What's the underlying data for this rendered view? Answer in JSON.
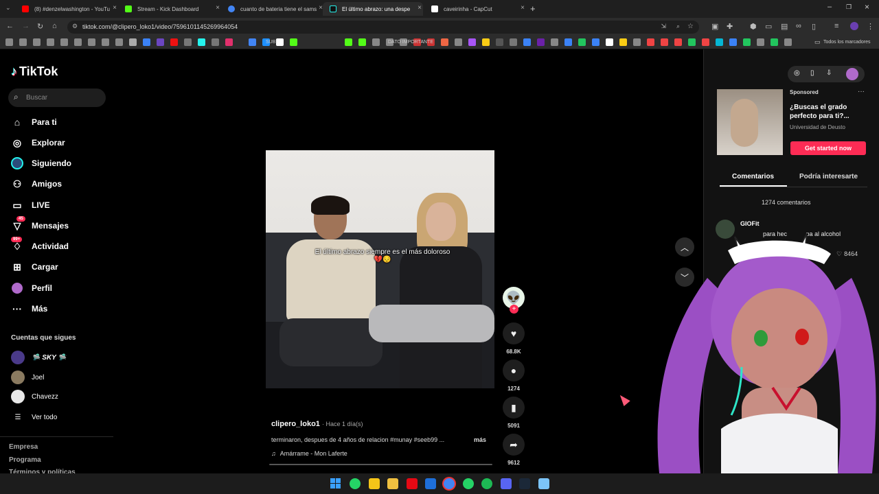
{
  "browser": {
    "tabs": [
      {
        "label": "(8) #denzelwashington - YouTu",
        "color": "#ff0000"
      },
      {
        "label": "Stream - Kick Dashboard",
        "color": "#53fc18"
      },
      {
        "label": "cuanto de bateria tiene el sams",
        "color": "#4285f4"
      },
      {
        "label": "El último abrazo: una despe",
        "color": "#25f4ee"
      },
      {
        "label": "caveirinha - CapCut",
        "color": "#ffffff"
      }
    ],
    "url": "tiktok.com/@clipero_loko1/video/7596101145269964054",
    "bookmark_texts": [
      "SUB",
      "DATO IMPORTANTE",
      "Todos los marcadores"
    ]
  },
  "tiktok": {
    "logo": "TikTok",
    "search_placeholder": "Buscar",
    "nav": [
      {
        "label": "Para ti",
        "icon": "home-icon"
      },
      {
        "label": "Explorar",
        "icon": "compass-icon"
      },
      {
        "label": "Siguiendo",
        "icon": "following-icon"
      },
      {
        "label": "Amigos",
        "icon": "friends-icon"
      },
      {
        "label": "LIVE",
        "icon": "live-icon"
      },
      {
        "label": "Mensajes",
        "icon": "messages-icon",
        "badge": "45"
      },
      {
        "label": "Actividad",
        "icon": "activity-icon",
        "badge": "99+"
      },
      {
        "label": "Cargar",
        "icon": "upload-icon"
      },
      {
        "label": "Perfil",
        "icon": "profile-icon"
      },
      {
        "label": "Más",
        "icon": "more-icon"
      }
    ],
    "following_title": "Cuentas que sigues",
    "following": [
      "🛸 SKY 🛸",
      "Joel",
      "Chavezz"
    ],
    "see_all": "Ver todo",
    "footer": [
      "Empresa",
      "Programa",
      "Términos y políticas"
    ]
  },
  "video": {
    "caption_overlay": "El último abrazo siempre es el más doloroso 💔😔",
    "author": "clipero_loko1",
    "time": "· Hace 1 día(s)",
    "description": "terminaron, despues de 4 años de relacion #munay #seeb99 ...",
    "more": "más",
    "music": "Amárrame - Mon Laferte",
    "likes": "68.8K",
    "comments": "1274",
    "saves": "5091",
    "shares": "9612"
  },
  "ad": {
    "label": "Sponsored",
    "title": "¿Buscas el grado perfecto para ti?...",
    "advertiser": "Universidad de Deusto",
    "cta": "Get started now"
  },
  "comments_panel": {
    "tabs": [
      "Comentarios",
      "Podría interesarte"
    ],
    "count": "1274 comentarios",
    "first_user": "GIOFit",
    "first_text": "para hec           pa al alcohol",
    "first_likes": "8464"
  },
  "colors": {
    "accent": "#fe2c55"
  }
}
